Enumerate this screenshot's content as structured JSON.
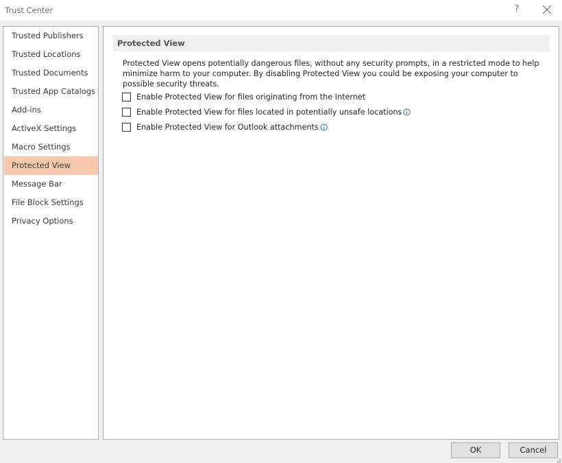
{
  "window": {
    "title": "Trust Center",
    "help_label": "?"
  },
  "nav": {
    "items": [
      {
        "label": "Trusted Publishers"
      },
      {
        "label": "Trusted Locations"
      },
      {
        "label": "Trusted Documents"
      },
      {
        "label": "Trusted App Catalogs"
      },
      {
        "label": "Add-ins"
      },
      {
        "label": "ActiveX Settings"
      },
      {
        "label": "Macro Settings"
      },
      {
        "label": "Protected View",
        "selected": true
      },
      {
        "label": "Message Bar"
      },
      {
        "label": "File Block Settings"
      },
      {
        "label": "Privacy Options"
      }
    ]
  },
  "content": {
    "header": "Protected View",
    "description": "Protected View opens potentially dangerous files, without any security prompts, in a restricted mode to help minimize harm to your computer. By disabling Protected View you could be exposing your computer to possible security threats.",
    "options": [
      {
        "label": "Enable Protected View for files originating from the Internet",
        "checked": false,
        "info_icon": false
      },
      {
        "label": "Enable Protected View for files located in potentially unsafe locations",
        "checked": false,
        "info_icon": true
      },
      {
        "label": "Enable Protected View for Outlook attachments",
        "checked": false,
        "info_icon": true
      }
    ]
  },
  "buttons": {
    "ok": "OK",
    "cancel": "Cancel"
  },
  "colors": {
    "selected_nav": "#f8c8af",
    "info_icon": "#2e75b6",
    "dialog_background": "#f0f0f0"
  },
  "icons": [
    "close-icon",
    "info-icon",
    "resize-grip-icon"
  ]
}
